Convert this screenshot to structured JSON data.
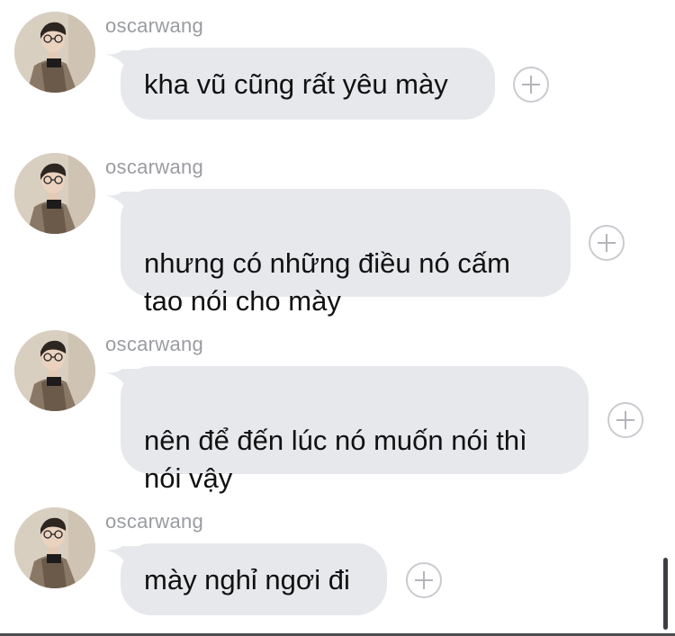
{
  "messages": [
    {
      "sender": "oscarwang",
      "text": "kha vũ cũng rất yêu mày"
    },
    {
      "sender": "oscarwang",
      "text": "nhưng có những điều nó cấm\ntao nói cho mày"
    },
    {
      "sender": "oscarwang",
      "text": "nên để đến lúc nó muốn nói thì\nnói vậy"
    },
    {
      "sender": "oscarwang",
      "text": "mày nghỉ ngơi đi"
    }
  ],
  "icons": {
    "react": "plus-circle-icon",
    "avatar": "profile-photo"
  },
  "colors": {
    "bubble": "#e6e8eb",
    "sender": "#9a9ca1",
    "text": "#111111",
    "plus_outline": "#c9cbcf"
  }
}
